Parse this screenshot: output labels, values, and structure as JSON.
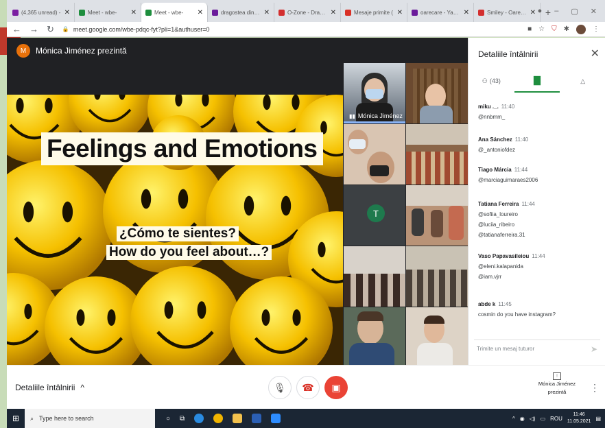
{
  "browser": {
    "tabs": [
      {
        "label": "(4,365 unread) - ",
        "color": "#7b1fa2",
        "active": false
      },
      {
        "label": "Meet - wbe-",
        "color": "#1e8e3e",
        "active": false
      },
      {
        "label": "Meet - wbe-",
        "color": "#1e8e3e",
        "active": true
      },
      {
        "label": "dragostea din tei",
        "color": "#6a1b9a",
        "active": false
      },
      {
        "label": "O-Zone - Dragos",
        "color": "#d32f2f",
        "active": false
      },
      {
        "label": "Mesaje primite (",
        "color": "#d93025",
        "active": false
      },
      {
        "label": "oarecare - Yahoo",
        "color": "#6a1b9a",
        "active": false
      },
      {
        "label": "Smiley - Oarecar",
        "color": "#d32f2f",
        "active": false
      }
    ],
    "new_tab": "+",
    "url": "meet.google.com/wbe-pdqc-fyt?pli=1&authuser=0"
  },
  "meet": {
    "presenter_initial": "M",
    "presenter_label": "Mónica Jiménez prezintă",
    "slide": {
      "title": "Feelings and Emotions",
      "q1": "¿Cómo te sientes?",
      "q2": "How do you feel about…?"
    },
    "tiles": [
      {
        "name": "Mónica Jiménez"
      },
      {
        "initial": "T"
      }
    ],
    "panel": {
      "title": "Detaliile întâlnirii",
      "people_count": "(43)",
      "messages": [
        {
          "author": "miku ._.",
          "time": "11:40",
          "lines": [
            "@nnbmm_"
          ]
        },
        {
          "author": "Ana Sánchez",
          "time": "11:40",
          "lines": [
            "@_antoniofdez"
          ]
        },
        {
          "author": "Tiago Márcia",
          "time": "11:44",
          "lines": [
            "@marciaguimaraes2006"
          ]
        },
        {
          "author": "Tatiana Ferreira",
          "time": "11:44",
          "lines": [
            "@sofiia_loureiro",
            "@luciia_ribeiro",
            "@tatianaferreira.31"
          ]
        },
        {
          "author": "Vaso Papavasileiou",
          "time": "11:44",
          "lines": [
            "@eleni.kalapanida",
            "@iam.vjrr"
          ]
        },
        {
          "author": "abde k",
          "time": "11:45",
          "lines": [
            "cosmin do you have instagram?"
          ]
        }
      ],
      "input_placeholder": "Trimite un mesaj tuturor"
    },
    "bottom": {
      "details_label": "Detaliile întâlnirii",
      "presenting_label": "Mónica Jiménez prezintă"
    }
  },
  "taskbar": {
    "search_placeholder": "Type here to search",
    "lang": "ROU",
    "time": "11:46",
    "date": "11.05.2021"
  }
}
